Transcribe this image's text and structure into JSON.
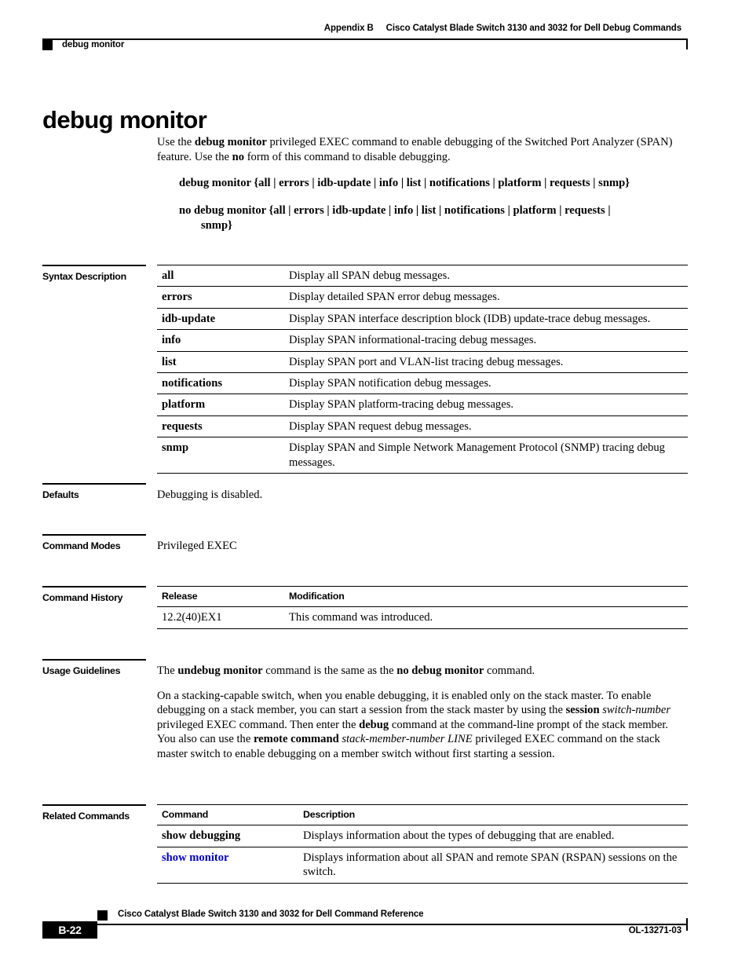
{
  "header": {
    "appendix": "Appendix B",
    "title": "Cisco Catalyst Blade Switch 3130 and 3032 for Dell Debug Commands",
    "running_head": "debug monitor"
  },
  "page_title": "debug monitor",
  "intro": {
    "part1": "Use the ",
    "bold1": "debug monitor",
    "part2": " privileged EXEC command to enable debugging of the Switched Port Analyzer (SPAN) feature. Use the ",
    "bold2": "no",
    "part3": " form of this command to disable debugging."
  },
  "syntax": {
    "line1": "debug monitor {all | errors | idb-update | info | list | notifications | platform | requests | snmp}",
    "line2_main": "no debug monitor {all | errors | idb-update | info | list | notifications | platform | requests |",
    "line2_cont": "snmp}"
  },
  "sections": {
    "syntax_description": "Syntax Description",
    "defaults": "Defaults",
    "command_modes": "Command Modes",
    "command_history": "Command History",
    "usage_guidelines": "Usage Guidelines",
    "related_commands": "Related Commands"
  },
  "syntax_table": {
    "rows": [
      {
        "keyword": "all",
        "description": "Display all SPAN debug messages."
      },
      {
        "keyword": "errors",
        "description": "Display detailed SPAN error debug messages."
      },
      {
        "keyword": "idb-update",
        "description": "Display SPAN interface description block (IDB) update-trace debug messages."
      },
      {
        "keyword": "info",
        "description": "Display SPAN informational-tracing debug messages."
      },
      {
        "keyword": "list",
        "description": "Display SPAN port and VLAN-list tracing debug messages."
      },
      {
        "keyword": "notifications",
        "description": "Display SPAN notification debug messages."
      },
      {
        "keyword": "platform",
        "description": "Display SPAN platform-tracing debug messages."
      },
      {
        "keyword": "requests",
        "description": "Display SPAN request debug messages."
      },
      {
        "keyword": "snmp",
        "description": "Display SPAN and Simple Network Management Protocol (SNMP) tracing debug messages."
      }
    ]
  },
  "defaults_text": "Debugging is disabled.",
  "command_modes_text": "Privileged EXEC",
  "command_history": {
    "col_release": "Release",
    "col_modification": "Modification",
    "rows": [
      {
        "release": "12.2(40)EX1",
        "modification": "This command was introduced."
      }
    ]
  },
  "usage": {
    "p1_a": "The ",
    "p1_b1": "undebug monitor",
    "p1_b": " command is the same as the ",
    "p1_b2": "no debug monitor",
    "p1_c": " command.",
    "p2_a": "On a stacking-capable switch, when you enable debugging, it is enabled only on the stack master. To enable debugging on a stack member, you can start a session from the stack master by using the ",
    "p2_b1": "session",
    "p2_b": " ",
    "p2_i1": "switch-number",
    "p2_c": " privileged EXEC command. Then enter the ",
    "p2_b2": "debug",
    "p2_d": " command at the command-line prompt of the stack member. You also can use the ",
    "p2_b3": "remote command",
    "p2_e": " ",
    "p2_i2": "stack-member-number LINE",
    "p2_f": " privileged EXEC command on the stack master switch to enable debugging on a member switch without first starting a session."
  },
  "related_commands": {
    "col_command": "Command",
    "col_description": "Description",
    "rows": [
      {
        "command": "show debugging",
        "description": "Displays information about the types of debugging that are enabled.",
        "is_link": false
      },
      {
        "command": "show monitor",
        "description": "Displays information about all SPAN and remote SPAN (RSPAN) sessions on the switch.",
        "is_link": true
      }
    ]
  },
  "footer": {
    "book_title": "Cisco Catalyst Blade Switch 3130 and 3032 for Dell Command Reference",
    "page_number": "B-22",
    "doc_id": "OL-13271-03"
  },
  "colors": {
    "link": "#0000CC",
    "rule": "#000000"
  }
}
